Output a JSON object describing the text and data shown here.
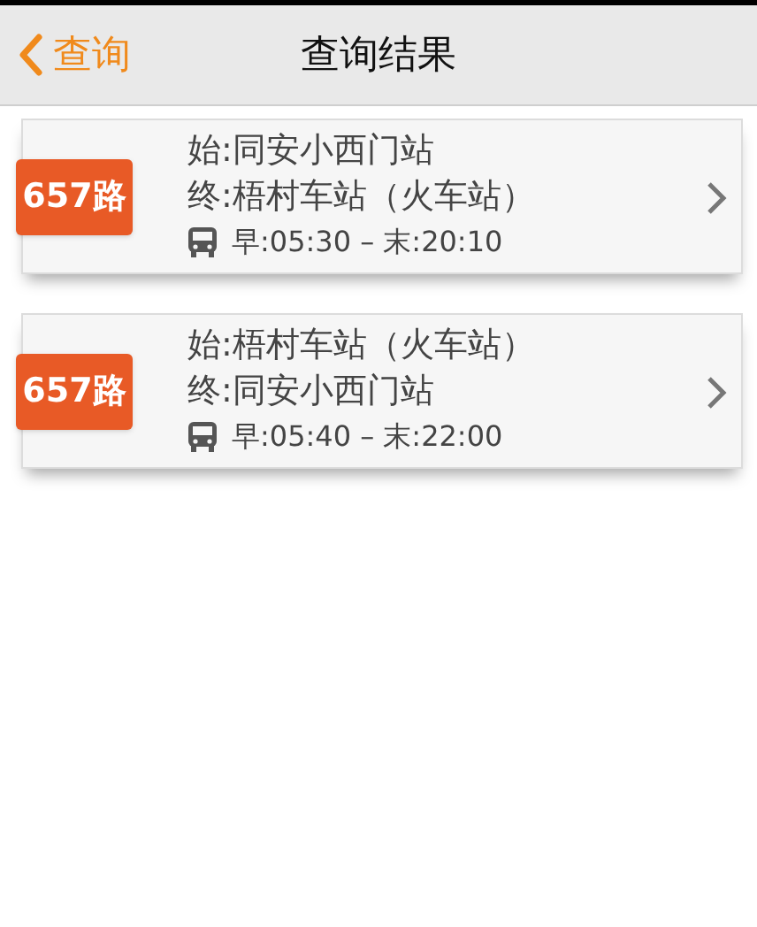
{
  "nav": {
    "back": "查询",
    "title": "查询结果"
  },
  "results": [
    {
      "route": "657路",
      "start": "始:同安小西门站",
      "end": "终:梧村车站（火车站）",
      "hours": "早:05:30 – 末:20:10"
    },
    {
      "route": "657路",
      "start": "始:梧村车站（火车站）",
      "end": "终:同安小西门站",
      "hours": "早:05:40 – 末:22:00"
    }
  ]
}
